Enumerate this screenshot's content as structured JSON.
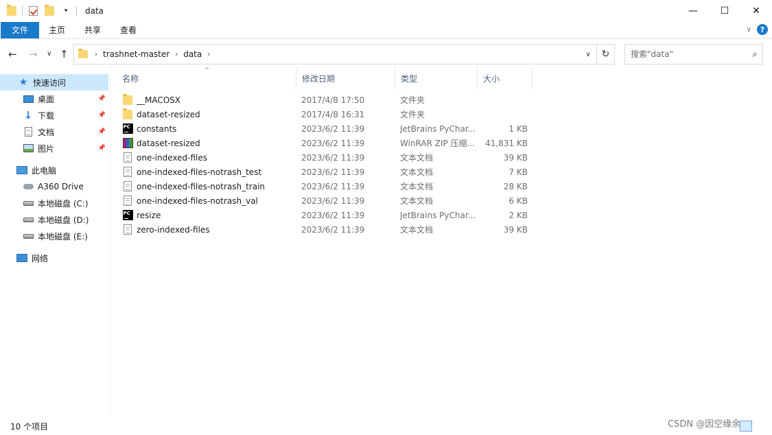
{
  "window": {
    "title": "data",
    "controls": {
      "minimize": "—",
      "maximize": "☐",
      "close": "✕"
    }
  },
  "ribbon": {
    "tabs": [
      {
        "label": "文件"
      },
      {
        "label": "主页"
      },
      {
        "label": "共享"
      },
      {
        "label": "查看"
      }
    ],
    "expand_glyph": "∨",
    "help_glyph": "?"
  },
  "navbar": {
    "back": "←",
    "forward": "→",
    "recent": "∨",
    "up": "↑",
    "breadcrumb": [
      "trashnet-master",
      "data"
    ],
    "search_placeholder": "搜索\"data\""
  },
  "sidebar": {
    "quick_access": {
      "label": "快速访问"
    },
    "pinned": [
      {
        "label": "桌面"
      },
      {
        "label": "下载"
      },
      {
        "label": "文档"
      },
      {
        "label": "图片"
      }
    ],
    "this_pc": {
      "label": "此电脑"
    },
    "drives": [
      {
        "label": "A360 Drive"
      },
      {
        "label": "本地磁盘 (C:)"
      },
      {
        "label": "本地磁盘 (D:)"
      },
      {
        "label": "本地磁盘 (E:)"
      }
    ],
    "network": {
      "label": "网络"
    }
  },
  "file_list": {
    "columns": {
      "name": "名称",
      "date": "修改日期",
      "type": "类型",
      "size": "大小"
    },
    "sort_glyph": "^",
    "rows": [
      {
        "icon": "folder-icon",
        "name": "__MACOSX",
        "date": "2017/4/8 17:50",
        "type": "文件夹",
        "size": ""
      },
      {
        "icon": "folder-icon",
        "name": "dataset-resized",
        "date": "2017/4/8 16:31",
        "type": "文件夹",
        "size": ""
      },
      {
        "icon": "pycharm-icon",
        "name": "constants",
        "date": "2023/6/2 11:39",
        "type": "JetBrains PyChar...",
        "size": "1 KB"
      },
      {
        "icon": "winrar-icon",
        "name": "dataset-resized",
        "date": "2023/6/2 11:39",
        "type": "WinRAR ZIP 压缩...",
        "size": "41,831 KB"
      },
      {
        "icon": "text-file-icon",
        "name": "one-indexed-files",
        "date": "2023/6/2 11:39",
        "type": "文本文档",
        "size": "39 KB"
      },
      {
        "icon": "text-file-icon",
        "name": "one-indexed-files-notrash_test",
        "date": "2023/6/2 11:39",
        "type": "文本文档",
        "size": "7 KB"
      },
      {
        "icon": "text-file-icon",
        "name": "one-indexed-files-notrash_train",
        "date": "2023/6/2 11:39",
        "type": "文本文档",
        "size": "28 KB"
      },
      {
        "icon": "text-file-icon",
        "name": "one-indexed-files-notrash_val",
        "date": "2023/6/2 11:39",
        "type": "文本文档",
        "size": "6 KB"
      },
      {
        "icon": "pycharm-icon",
        "name": "resize",
        "date": "2023/6/2 11:39",
        "type": "JetBrains PyChar...",
        "size": "2 KB"
      },
      {
        "icon": "text-file-icon",
        "name": "zero-indexed-files",
        "date": "2023/6/2 11:39",
        "type": "文本文档",
        "size": "39 KB"
      }
    ]
  },
  "status": {
    "item_count": "10 个项目"
  },
  "watermark": "CSDN @因空缘余"
}
